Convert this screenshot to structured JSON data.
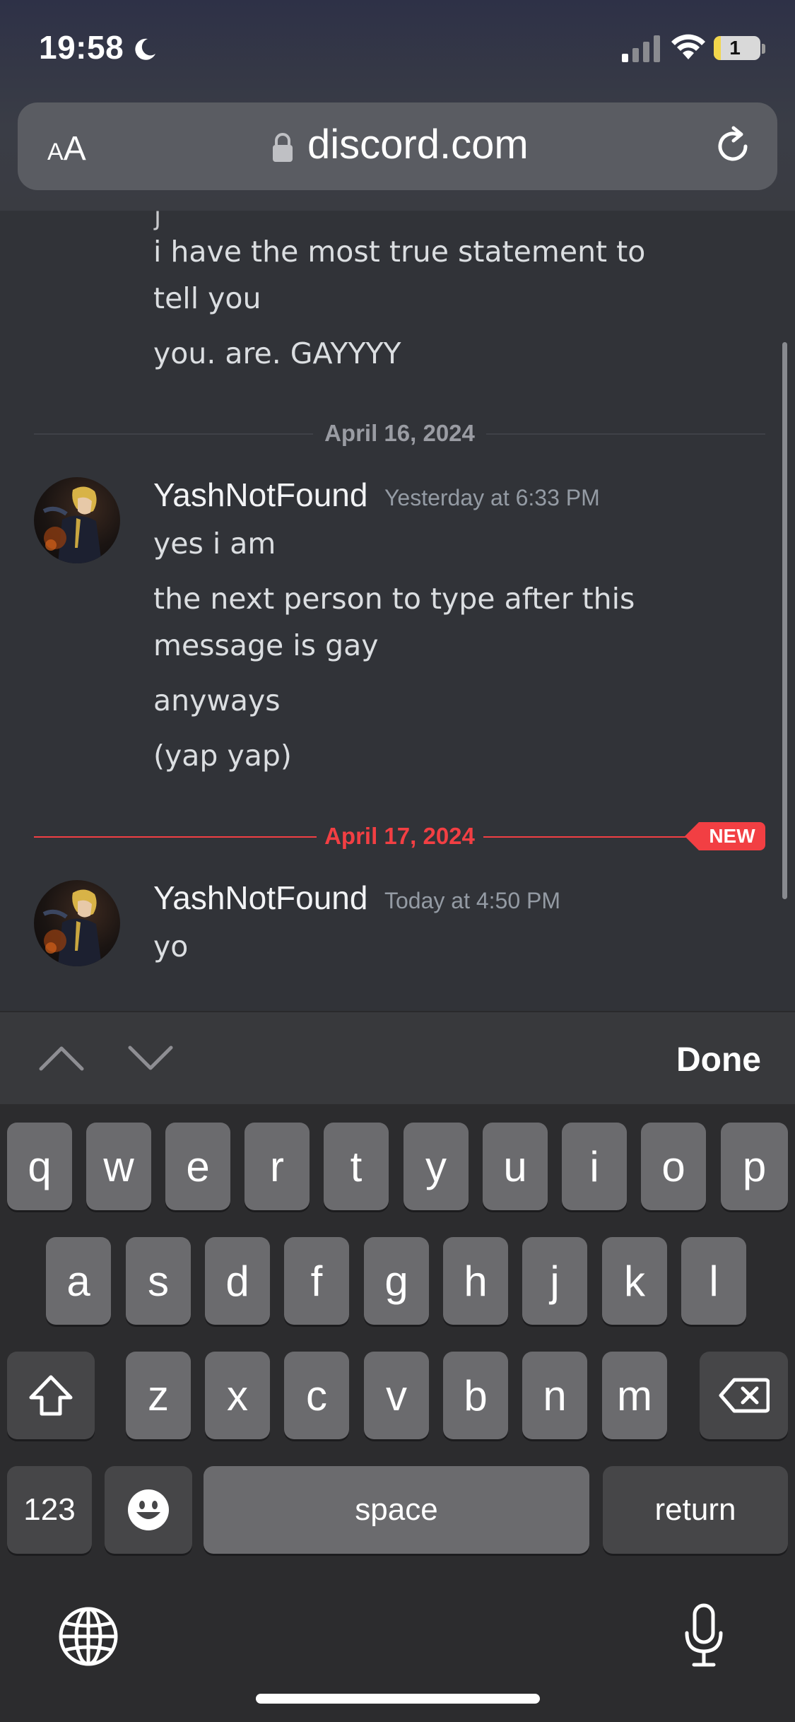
{
  "status_bar": {
    "time": "19:58",
    "battery": "1",
    "icons": [
      "moon-icon",
      "signal-icon",
      "wifi-icon",
      "battery-icon"
    ]
  },
  "browser": {
    "text_size_small": "A",
    "text_size_large": "A",
    "url": "discord.com",
    "icons": [
      "lock-icon",
      "reload-icon"
    ]
  },
  "chat": {
    "earlier_lines": [
      "i have the most true statement to",
      "tell you",
      "you. are. GAYYYY"
    ],
    "divider_1": "April 16, 2024",
    "message_1": {
      "username": "YashNotFound",
      "timestamp": "Yesterday at 6:33 PM",
      "lines": [
        "yes i am",
        "the next person to type after this",
        "message is gay",
        "anyways",
        "(yap yap)"
      ]
    },
    "divider_2": "April 17, 2024",
    "new_badge": "NEW",
    "message_2": {
      "username": "YashNotFound",
      "timestamp": "Today at 4:50 PM",
      "lines": [
        "yo"
      ]
    }
  },
  "accessory_bar": {
    "done_label": "Done",
    "icons": [
      "chevron-up-icon",
      "chevron-down-icon"
    ]
  },
  "keyboard": {
    "row1": [
      "q",
      "w",
      "e",
      "r",
      "t",
      "y",
      "u",
      "i",
      "o",
      "p"
    ],
    "row2": [
      "a",
      "s",
      "d",
      "f",
      "g",
      "h",
      "j",
      "k",
      "l"
    ],
    "row3": [
      "z",
      "x",
      "c",
      "v",
      "b",
      "n",
      "m"
    ],
    "numbers_label": "123",
    "space_label": "space",
    "return_label": "return",
    "icons": [
      "shift-icon",
      "backspace-icon",
      "emoji-icon",
      "globe-icon",
      "microphone-icon"
    ]
  },
  "colors": {
    "chat_background": "#313338",
    "new_divider": "#f23f43",
    "key_background": "#6b6b6e",
    "key_dark_background": "#464648"
  }
}
